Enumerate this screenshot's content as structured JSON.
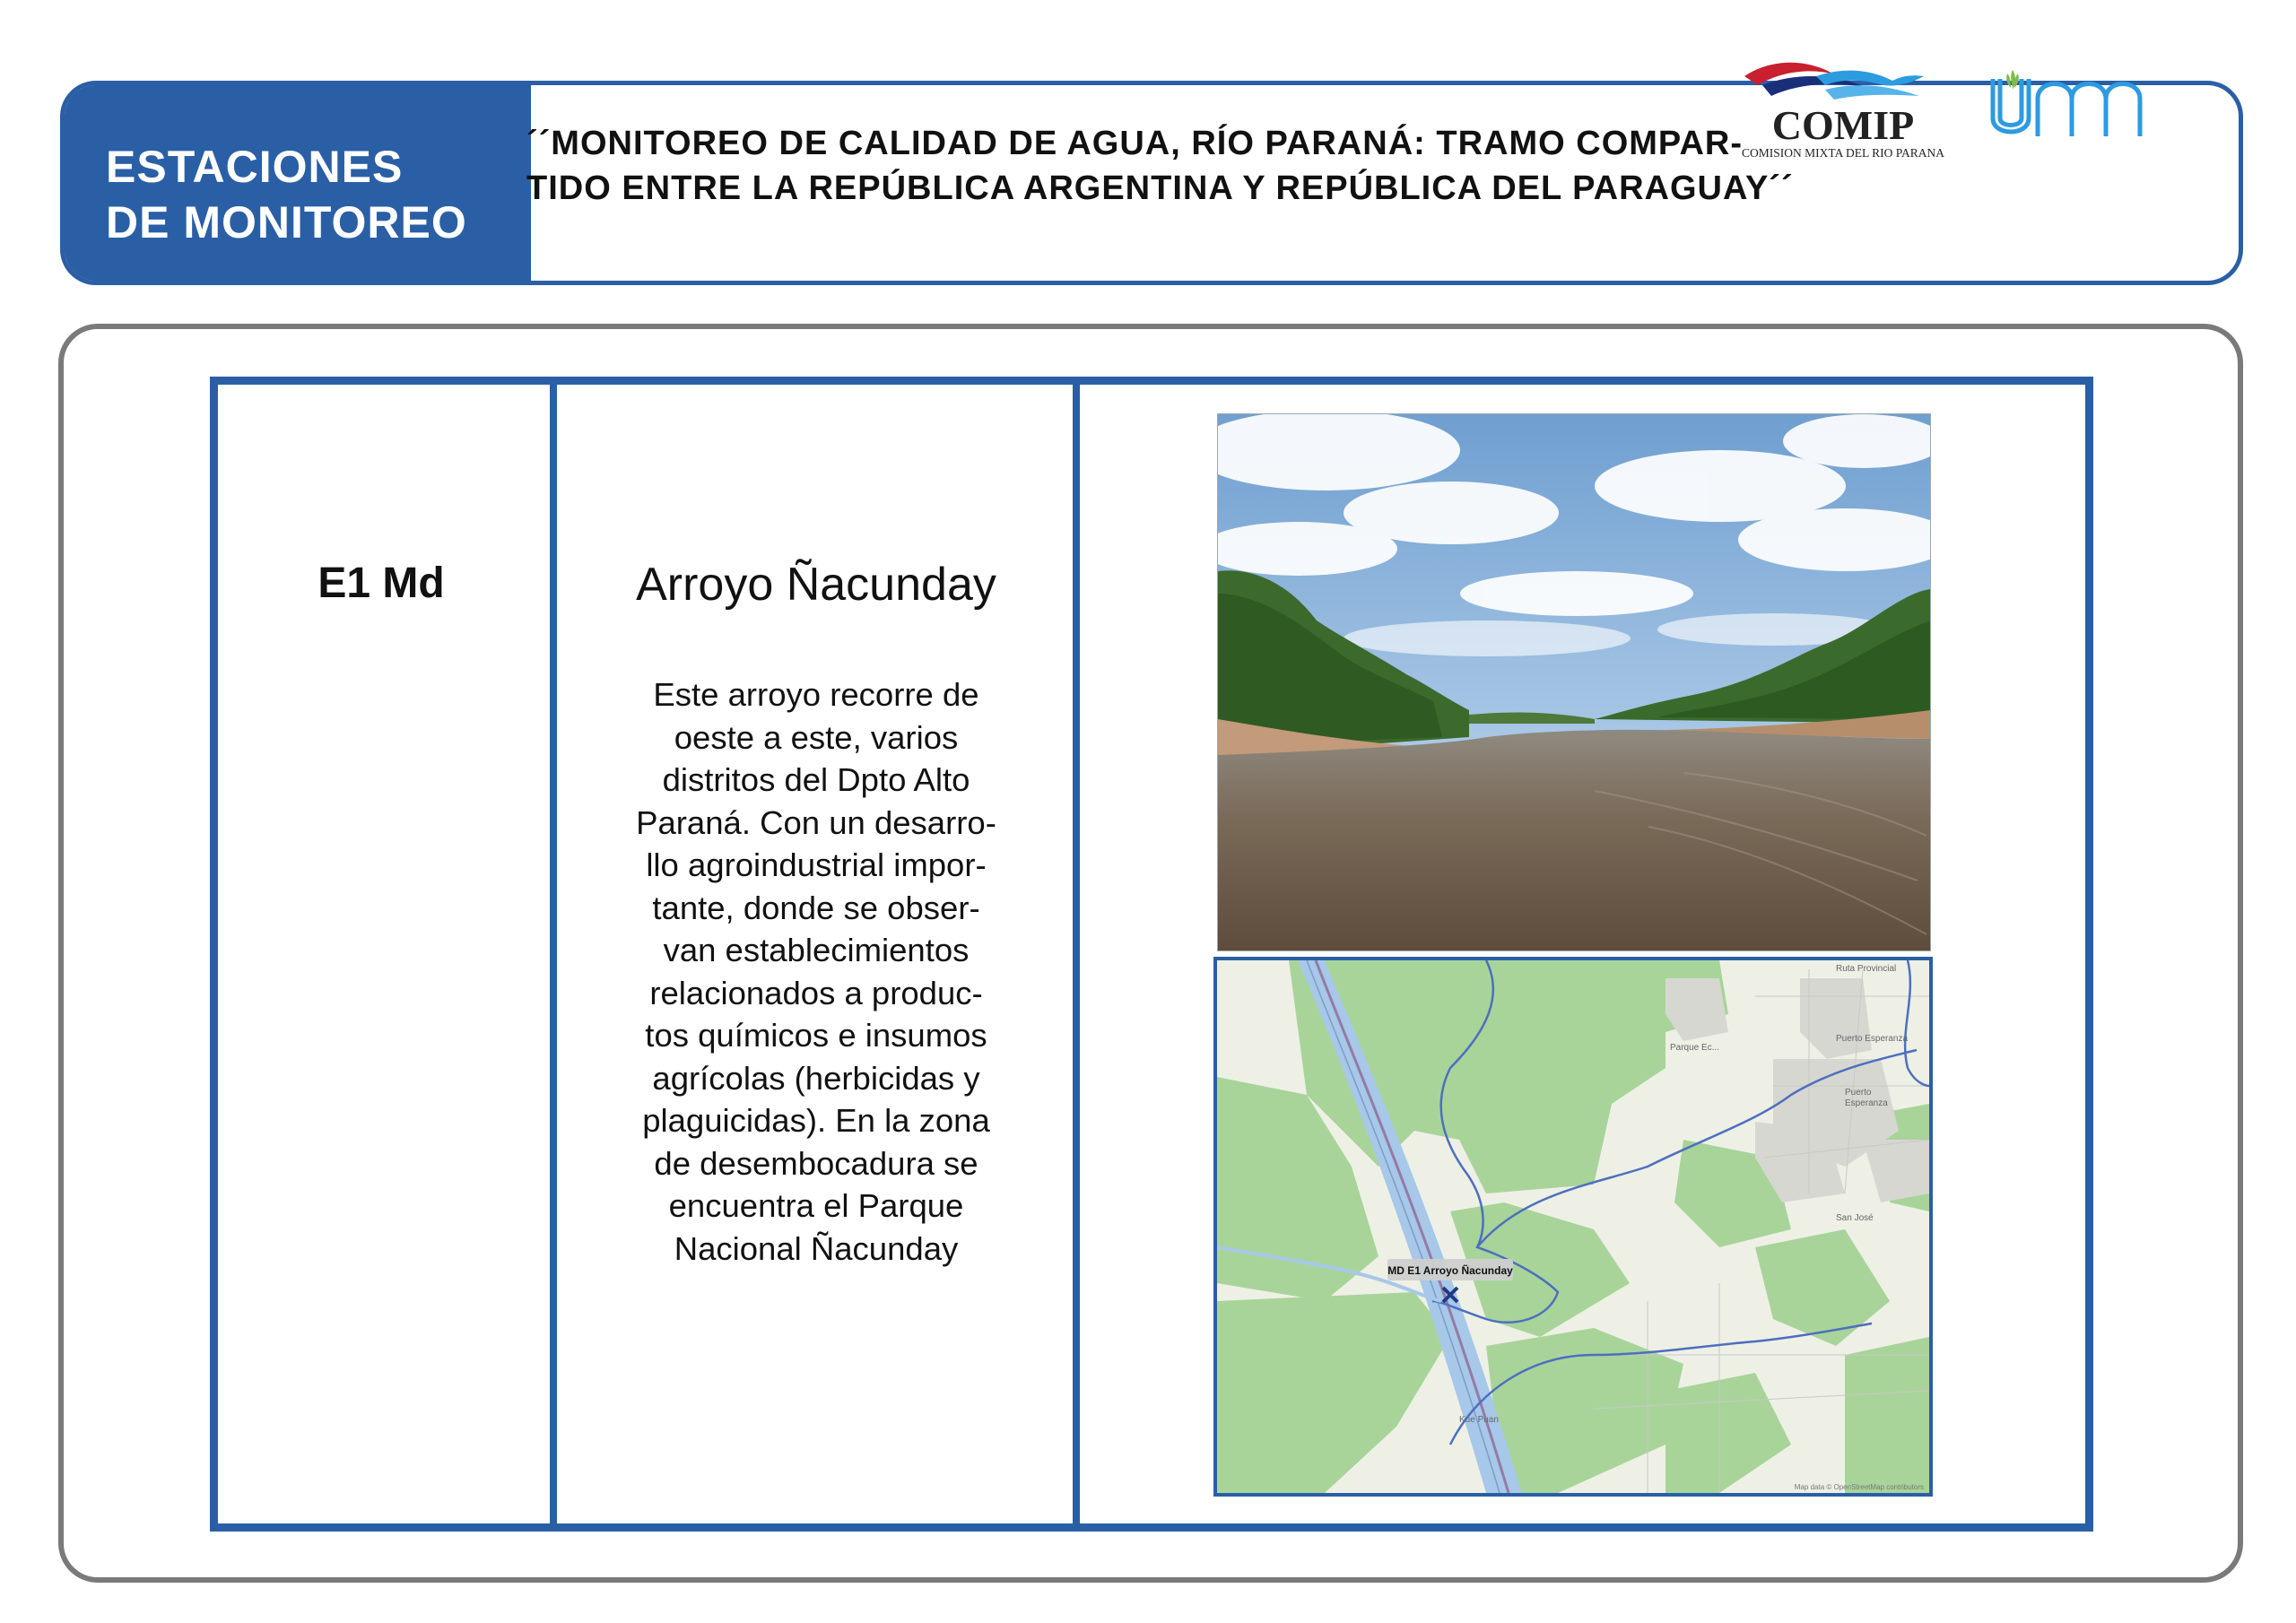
{
  "header": {
    "section_line1": "ESTACIONES",
    "section_line2": "DE MONITOREO",
    "title_line1": "´´MONITOREO DE CALIDAD DE AGUA, RÍO PARANÁ: TRAMO COMPAR-",
    "title_line2": "TIDO ENTRE LA REPÚBLICA ARGENTINA Y REPÚBLICA DEL PARAGUAY´´",
    "logo_comip_text": "COMIP",
    "logo_comip_subtext": "COMISION MIXTA DEL RIO PARANA",
    "logo_unm_text": "UNM"
  },
  "station": {
    "code": "E1 Md",
    "name": "Arroyo Ñacunday",
    "description_lines": [
      "Este arroyo recorre de",
      "oeste a este, varios",
      "distritos del Dpto Alto",
      "Paraná. Con un desarro-",
      "llo agroindustrial impor-",
      "tante, donde se obser-",
      "van establecimientos",
      "relacionados a produc-",
      "tos químicos e insumos",
      "agrícolas (herbicidas y",
      "plaguicidas). En la zona",
      "de desembocadura se",
      "encuentra el Parque",
      "Nacional Ñacunday"
    ]
  },
  "map": {
    "marker_label": "MD E1 Arroyo Ñacunday",
    "place_labels": [
      "Parque Ec...",
      "Puerto Esperanza",
      "Puerto",
      "Esperanza",
      "Ruta Provincial",
      "San José",
      "Kue Puan"
    ],
    "attribution": "Map data © OpenStreetMap contributors"
  },
  "colors": {
    "brand_blue": "#2a5fa6",
    "frame_gray": "#7a7a7a",
    "comip_red": "#c8202e",
    "map_green": "#a8d49a",
    "river_blue": "#a7c8e8"
  }
}
